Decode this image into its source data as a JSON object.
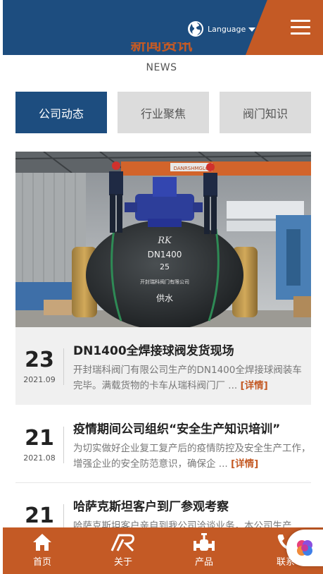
{
  "header": {
    "language_label": "Language",
    "accent_color": "#1d4d7f",
    "brand_orange": "#c45a25"
  },
  "section": {
    "title": "新闻资讯",
    "subtitle": "NEWS"
  },
  "tabs": [
    {
      "label": "公司动态",
      "active": true
    },
    {
      "label": "行业聚焦",
      "active": false
    },
    {
      "label": "阀门知识",
      "active": false
    }
  ],
  "featured_photo": {
    "valve_marking_line1": "DN1400",
    "valve_marking_line2": "25",
    "valve_marking_line3": "开封瑞科阀门有限公司",
    "valve_marking_line4": "供水",
    "crane_sign": "DANRSHMGLQ"
  },
  "news": [
    {
      "day": "23",
      "year_month": "2021.09",
      "title": "DN1400全焊接球阀发货现场",
      "summary": "开封瑞科阀门有限公司生产的DN1400全焊接球阀装车完毕。满载货物的卡车从瑞科阀门厂",
      "more": "[详情]"
    },
    {
      "day": "21",
      "year_month": "2021.08",
      "title": "疫情期间公司组织“安全生产知识培训”",
      "summary": "为切实做好企业复工复产后的疫情防控及安全生产工作，增强企业的安全防范意识，确保企",
      "more": "[详情]"
    },
    {
      "day": "21",
      "year_month": "",
      "title": "哈萨克斯坦客户到厂参观考察",
      "summary": "哈萨克斯坦客户亲自到我公司洽谈业务，本公司生产",
      "more": ""
    }
  ],
  "bottom_nav": [
    {
      "label": "首页",
      "icon": "home-icon"
    },
    {
      "label": "关于",
      "icon": "brand-logo-icon"
    },
    {
      "label": "产品",
      "icon": "valve-icon"
    },
    {
      "label": "联系",
      "icon": "phone-icon"
    }
  ],
  "float_widget": {
    "icon": "ai-assistant-icon"
  }
}
